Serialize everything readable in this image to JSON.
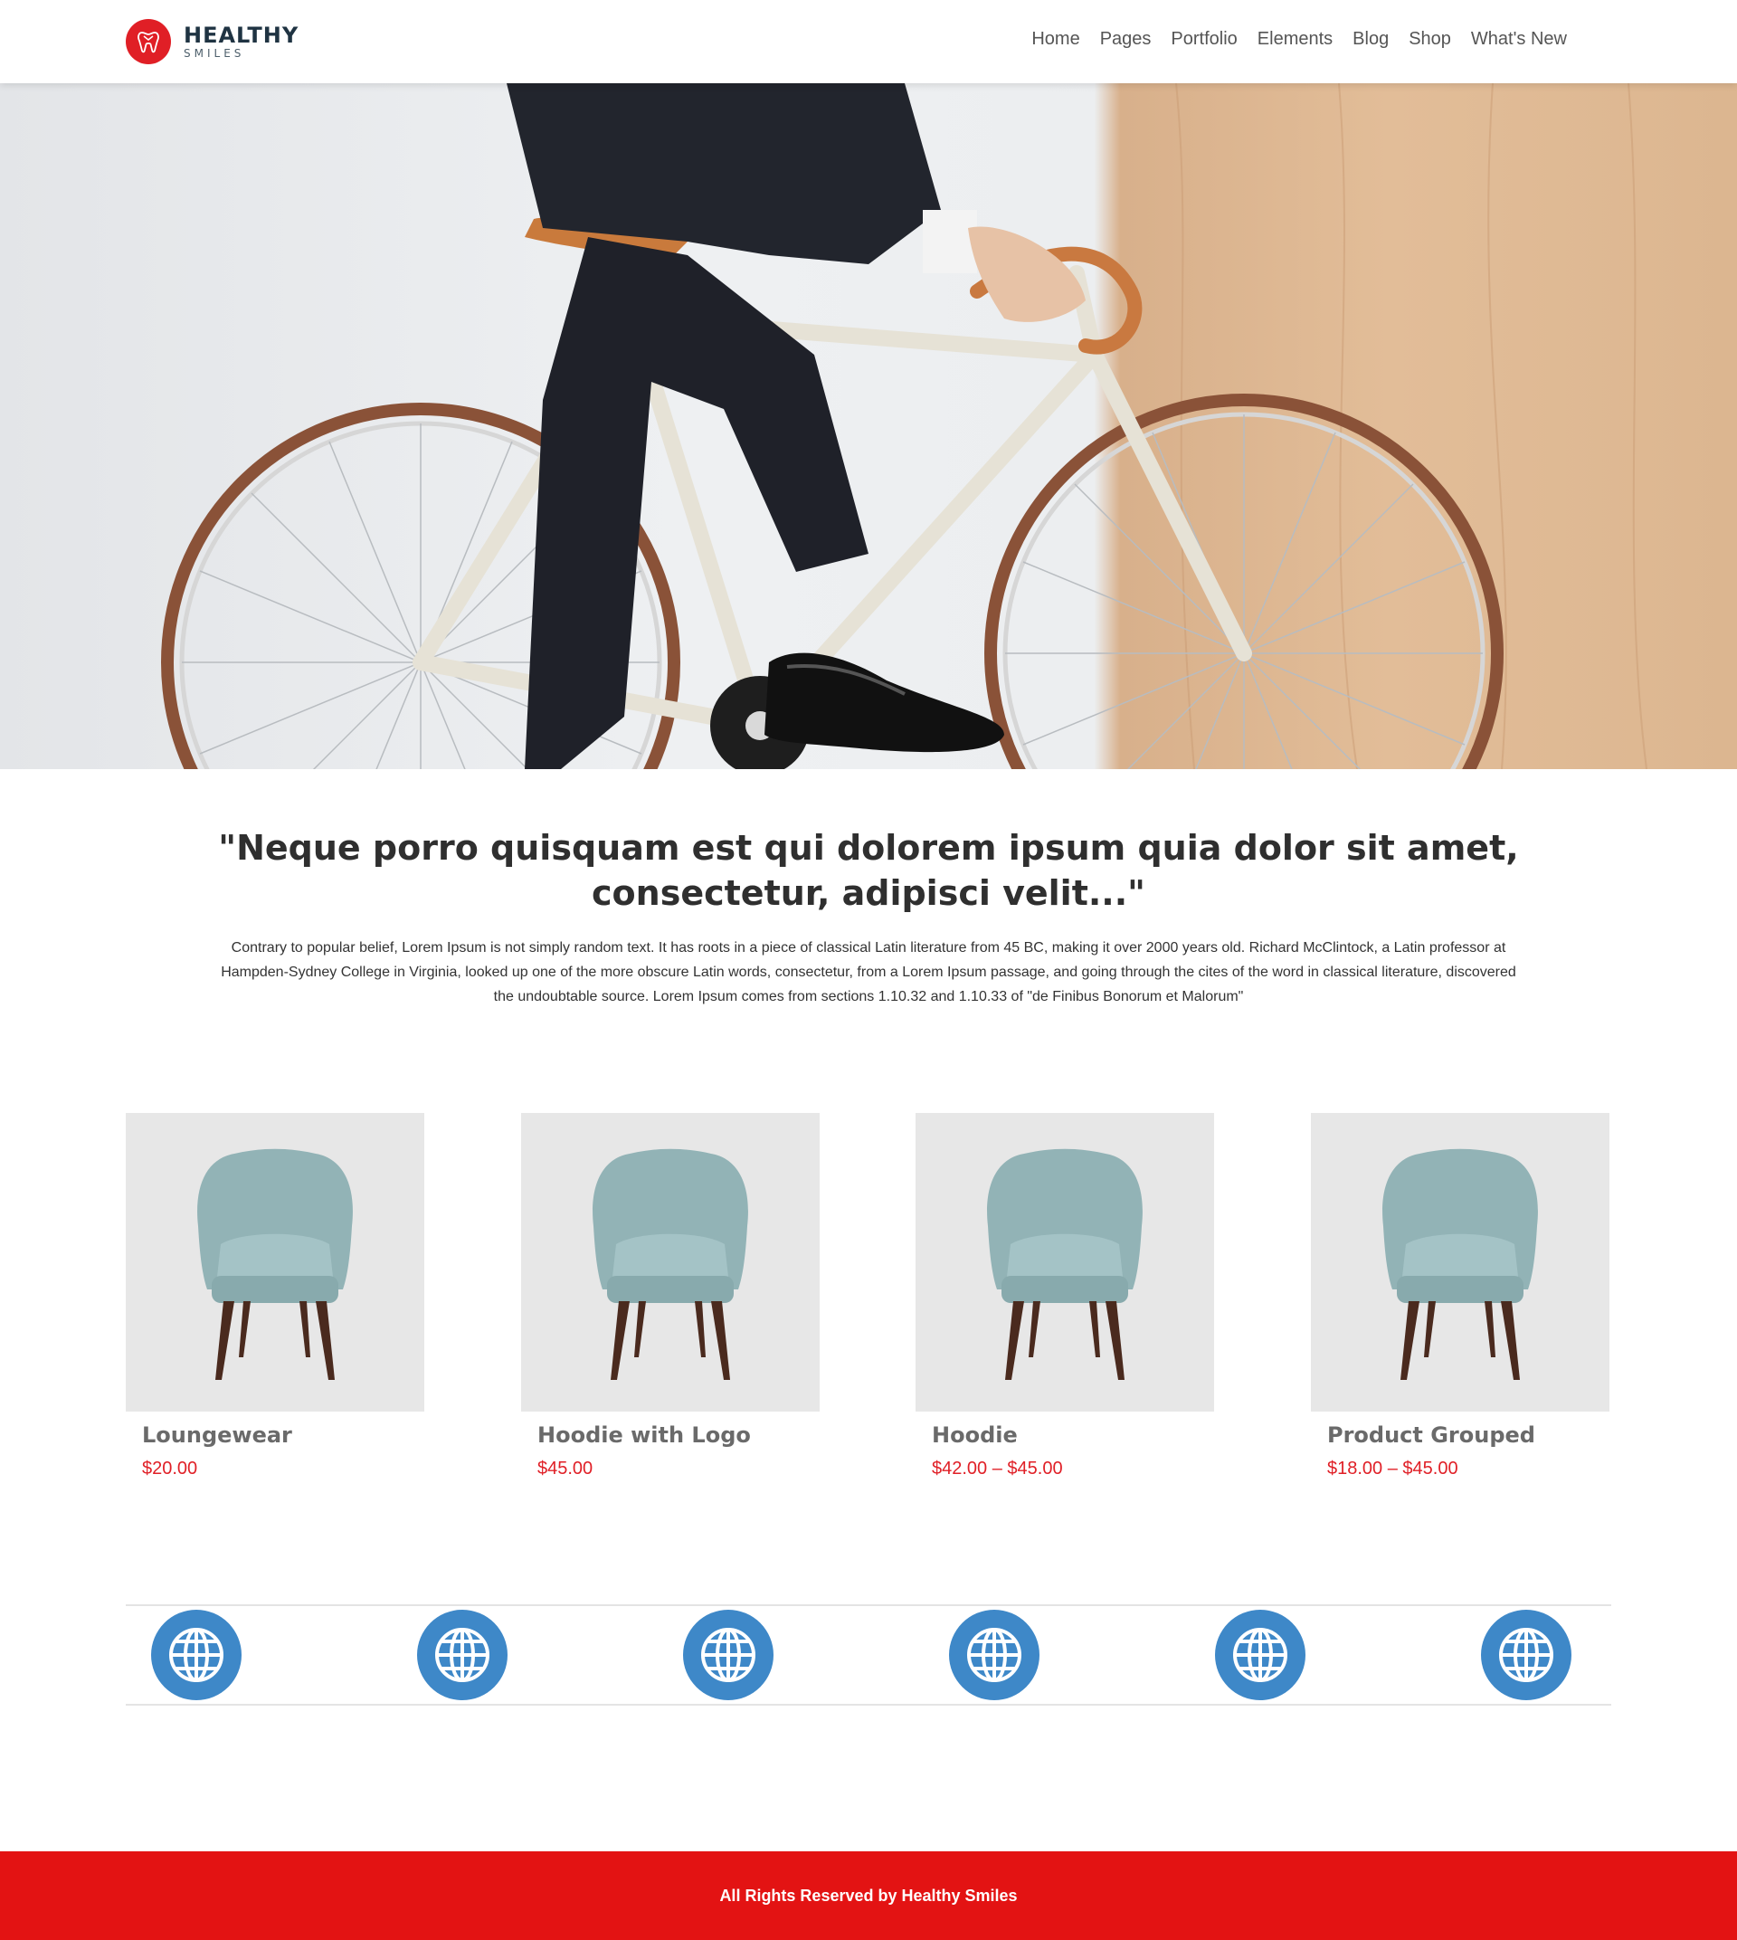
{
  "brand": {
    "title": "HEALTHY",
    "subtitle": "SMILES",
    "accent_color": "#e01f26",
    "logo_icon": "tooth-icon"
  },
  "nav": {
    "items": [
      {
        "label": "Home"
      },
      {
        "label": "Pages"
      },
      {
        "label": "Portfolio"
      },
      {
        "label": "Elements"
      },
      {
        "label": "Blog"
      },
      {
        "label": "Shop"
      },
      {
        "label": "What's New"
      }
    ]
  },
  "hero": {
    "image": "man-riding-bicycle-photo"
  },
  "content": {
    "quote": "\"Neque porro quisquam est qui dolorem ipsum quia dolor sit amet, consectetur, adipisci velit...\"",
    "paragraph": "Contrary to popular belief, Lorem Ipsum is not simply random text. It has roots in a piece of classical Latin literature from 45 BC, making it over 2000 years old. Richard McClintock, a Latin professor at Hampden-Sydney College in Virginia, looked up one of the more obscure Latin words, consectetur, from a Lorem Ipsum passage, and going through the cites of the word in classical literature, discovered the undoubtable source. Lorem Ipsum comes from sections 1.10.32 and 1.10.33 of \"de Finibus Bonorum et Malorum\""
  },
  "products": [
    {
      "name": "Loungewear",
      "price": "$20.00",
      "image": "armchair-image"
    },
    {
      "name": "Hoodie with Logo",
      "price": "$45.00",
      "image": "armchair-image"
    },
    {
      "name": "Hoodie",
      "price": "$42.00 – $45.00",
      "image": "armchair-image"
    },
    {
      "name": "Product Grouped",
      "price": "$18.00 – $45.00",
      "image": "armchair-image"
    }
  ],
  "icons": {
    "count": 6,
    "name": "globe-icon",
    "color": "#3e88c8"
  },
  "footer": {
    "text": "All Rights Reserved by Healthy Smiles",
    "background": "#e31313"
  }
}
